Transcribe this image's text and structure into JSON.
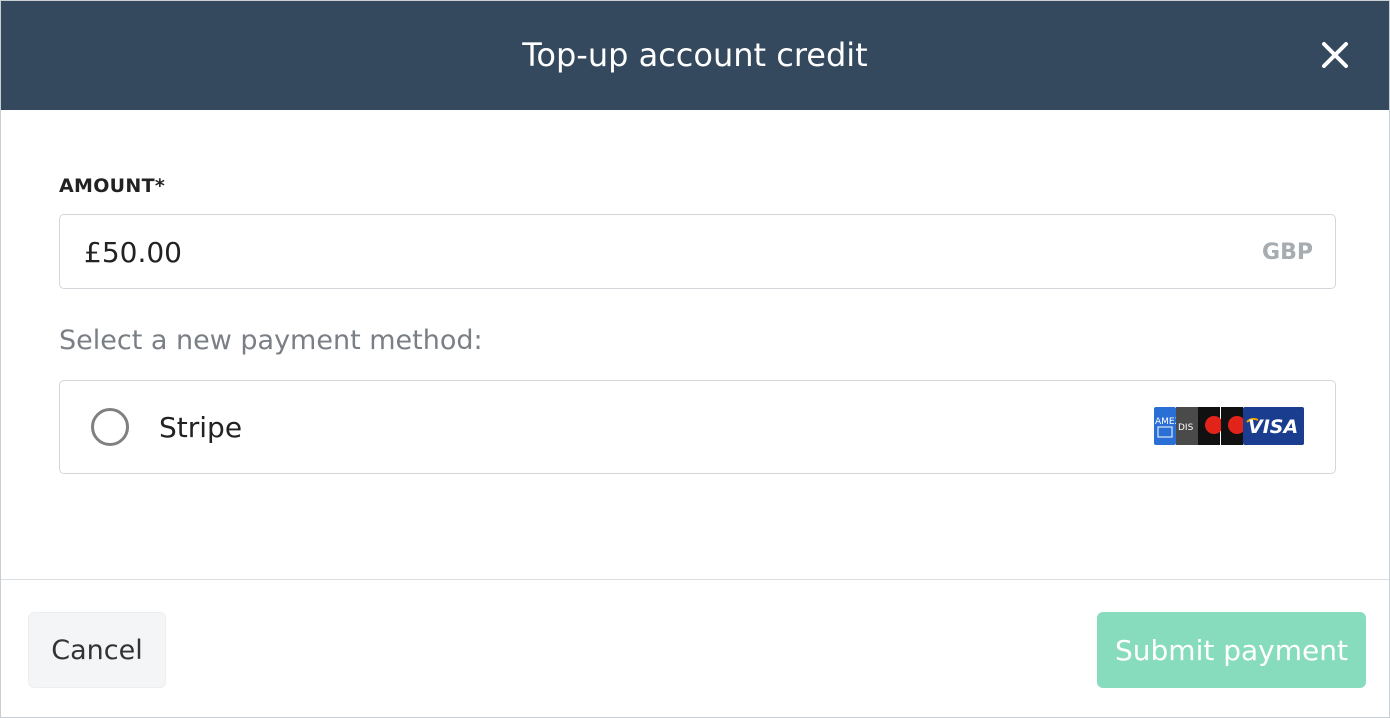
{
  "modal": {
    "title": "Top-up account credit",
    "close_icon": "close-icon"
  },
  "amount": {
    "label": "AMOUNT*",
    "value": "£50.00",
    "currency": "GBP"
  },
  "payment": {
    "section_label": "Select a new payment method:",
    "options": [
      {
        "label": "Stripe",
        "selected": false,
        "card_logos": [
          "amex",
          "discover",
          "mastercard",
          "maestro",
          "visa"
        ],
        "card_logo_text": {
          "amex": "AMEX",
          "discover": "DIS",
          "visa": "VISA"
        }
      }
    ]
  },
  "footer": {
    "cancel_label": "Cancel",
    "submit_label": "Submit payment"
  },
  "colors": {
    "header_bg": "#34495e",
    "submit_bg": "#88dcbe",
    "cancel_bg": "#f4f5f7"
  }
}
